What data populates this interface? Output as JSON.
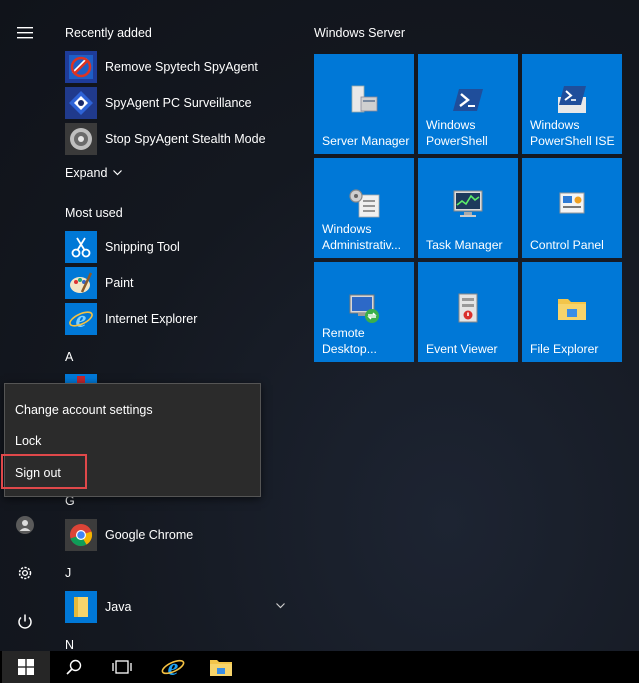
{
  "rail": {
    "items": [
      {
        "name": "hamburger-icon"
      },
      {
        "name": "user-icon"
      },
      {
        "name": "gear-icon"
      },
      {
        "name": "power-icon"
      }
    ]
  },
  "app_list": {
    "recently_added_header": "Recently added",
    "recently_added": [
      {
        "label": "Remove Spytech SpyAgent"
      },
      {
        "label": "SpyAgent PC Surveillance"
      },
      {
        "label": "Stop SpyAgent Stealth Mode"
      }
    ],
    "expand_label": "Expand",
    "most_used_header": "Most used",
    "most_used": [
      {
        "label": "Snipping Tool"
      },
      {
        "label": "Paint"
      },
      {
        "label": "Internet Explorer"
      }
    ],
    "letters": {
      "a": "A",
      "g": "G",
      "j": "J",
      "n": "N"
    },
    "g_apps": [
      {
        "label": "Google Chrome"
      }
    ],
    "j_apps": [
      {
        "label": "Java"
      }
    ]
  },
  "tiles": {
    "group_title": "Windows Server",
    "items": [
      {
        "label": "Server Manager",
        "icon": "server-manager-icon"
      },
      {
        "label": "Windows PowerShell",
        "icon": "powershell-icon"
      },
      {
        "label": "Windows PowerShell ISE",
        "icon": "powershell-ise-icon"
      },
      {
        "label": "Windows Administrativ...",
        "icon": "admin-tools-icon"
      },
      {
        "label": "Task Manager",
        "icon": "task-manager-icon"
      },
      {
        "label": "Control Panel",
        "icon": "control-panel-icon"
      },
      {
        "label": "Remote Desktop...",
        "icon": "remote-desktop-icon"
      },
      {
        "label": "Event Viewer",
        "icon": "event-viewer-icon"
      },
      {
        "label": "File Explorer",
        "icon": "file-explorer-icon"
      }
    ]
  },
  "context_menu": {
    "items": [
      {
        "label": "Change account settings"
      },
      {
        "label": "Lock"
      },
      {
        "label": "Sign out"
      }
    ]
  },
  "taskbar": {
    "items": [
      {
        "name": "windows-start-icon"
      },
      {
        "name": "search-icon"
      },
      {
        "name": "task-view-icon"
      },
      {
        "name": "internet-explorer-icon"
      },
      {
        "name": "file-explorer-icon"
      }
    ]
  },
  "colors": {
    "tile_blue": "#0078d7",
    "highlight_red": "#e0484a",
    "menu_bg": "#2b2b2b"
  }
}
